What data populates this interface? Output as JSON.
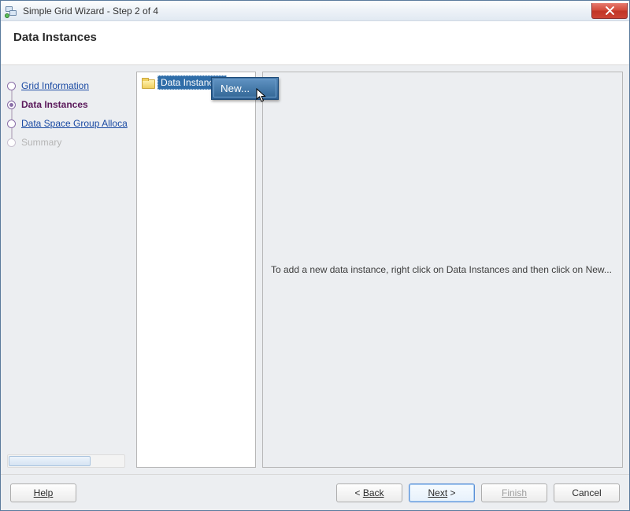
{
  "window": {
    "title": "Simple Grid Wizard - Step 2 of 4"
  },
  "header": {
    "title": "Data Instances"
  },
  "sidebar": {
    "steps": [
      {
        "label": "Grid Information",
        "state": "link"
      },
      {
        "label": "Data Instances",
        "state": "current"
      },
      {
        "label": "Data Space Group Alloca",
        "state": "link"
      },
      {
        "label": "Summary",
        "state": "dim"
      }
    ]
  },
  "tree": {
    "root_label": "Data Instances",
    "context_menu": {
      "items": [
        "New..."
      ]
    }
  },
  "content": {
    "hint": "To add a new data instance, right click on Data Instances and then click on New..."
  },
  "footer": {
    "help": "Help",
    "back_prefix": "< ",
    "back": "Back",
    "next": "Next",
    "next_suffix": " >",
    "finish": "Finish",
    "cancel": "Cancel"
  }
}
